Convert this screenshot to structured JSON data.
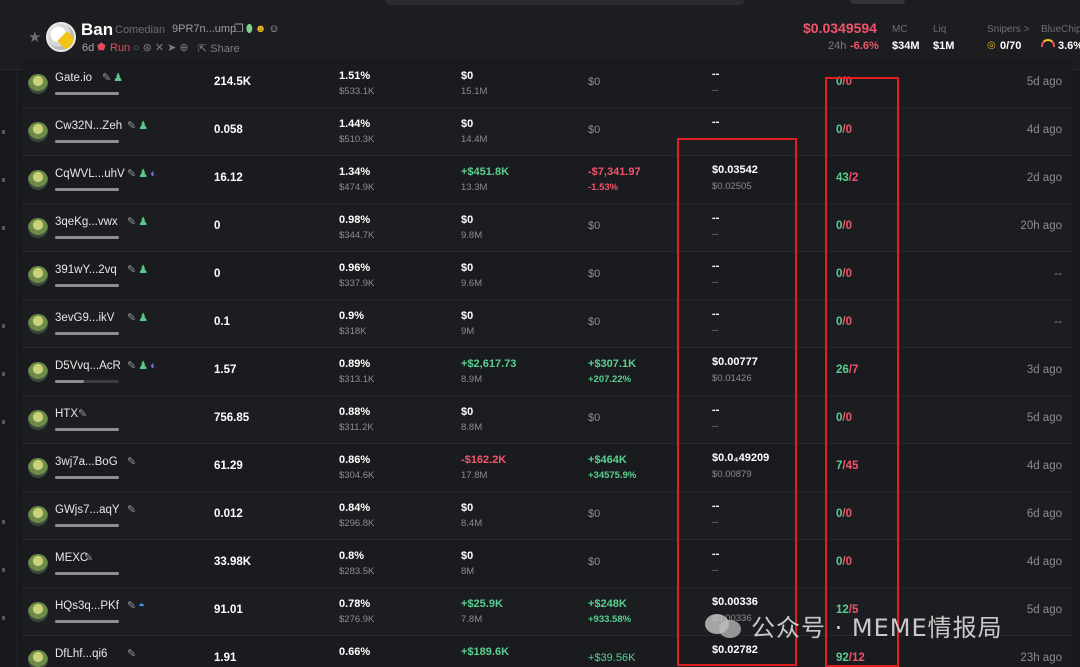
{
  "header": {
    "token_name": "Ban",
    "token_full_name": "Comedian",
    "token_address": "9PR7n...ump",
    "age": "6d",
    "run_label": "Run",
    "share_label": "Share",
    "price": "$0.0349594",
    "change_label": "24h",
    "change_value": "-6.6%",
    "mc_label": "MC",
    "mc_value": "$34M",
    "liq_label": "Liq",
    "liq_value": "$1M",
    "snipers_label": "Snipers >",
    "snipers_value": "0/70",
    "bluechip_label": "BlueChip",
    "bluechip_value": "3.6%"
  },
  "rows": [
    {
      "name": "Gate.io",
      "icons": [
        "pencil",
        "person"
      ],
      "bar": 1.0,
      "balance": "214.5K",
      "pct": "1.51%",
      "pct_usd": "$533.1K",
      "bought": "$0",
      "bought_class": "",
      "bought_sub": "15.1M",
      "pnl": "$0",
      "pnl_class": "",
      "pnl_sub": "",
      "pnl_sub_class": "",
      "avg": "--",
      "avg_sub": "--",
      "buys": "0",
      "sells": "0",
      "age": "5d ago"
    },
    {
      "name": "Cw32N...Zeh",
      "icons": [
        "pencil",
        "person"
      ],
      "bar": 1.0,
      "balance": "0.058",
      "pct": "1.44%",
      "pct_usd": "$510.3K",
      "bought": "$0",
      "bought_class": "",
      "bought_sub": "14.4M",
      "pnl": "$0",
      "pnl_class": "",
      "pnl_sub": "",
      "pnl_sub_class": "",
      "avg": "--",
      "avg_sub": "",
      "buys": "0",
      "sells": "0",
      "age": "4d ago"
    },
    {
      "name": "CqWVL...uhV",
      "icons": [
        "pencil",
        "person",
        "moon"
      ],
      "bar": 1.0,
      "balance": "16.12",
      "pct": "1.34%",
      "pct_usd": "$474.9K",
      "bought": "+$451.8K",
      "bought_class": "up",
      "bought_sub": "13.3M",
      "pnl": "-$7,341.97",
      "pnl_class": "down",
      "pnl_sub": "-1.53%",
      "pnl_sub_class": "down",
      "avg": "$0.03542",
      "avg_sub": "$0.02505",
      "buys": "43",
      "sells": "2",
      "age": "2d ago"
    },
    {
      "name": "3qeKg...vwx",
      "icons": [
        "pencil",
        "person"
      ],
      "bar": 1.0,
      "balance": "0",
      "pct": "0.98%",
      "pct_usd": "$344.7K",
      "bought": "$0",
      "bought_class": "",
      "bought_sub": "9.8M",
      "pnl": "$0",
      "pnl_class": "",
      "pnl_sub": "",
      "pnl_sub_class": "",
      "avg": "--",
      "avg_sub": "--",
      "buys": "0",
      "sells": "0",
      "age": "20h ago"
    },
    {
      "name": "391wY...2vq",
      "icons": [
        "pencil",
        "person"
      ],
      "bar": 1.0,
      "balance": "0",
      "pct": "0.96%",
      "pct_usd": "$337.9K",
      "bought": "$0",
      "bought_class": "",
      "bought_sub": "9.6M",
      "pnl": "$0",
      "pnl_class": "",
      "pnl_sub": "",
      "pnl_sub_class": "",
      "avg": "--",
      "avg_sub": "--",
      "buys": "0",
      "sells": "0",
      "age": "--"
    },
    {
      "name": "3evG9...ikV",
      "icons": [
        "pencil",
        "person"
      ],
      "bar": 1.0,
      "balance": "0.1",
      "pct": "0.9%",
      "pct_usd": "$318K",
      "bought": "$0",
      "bought_class": "",
      "bought_sub": "9M",
      "pnl": "$0",
      "pnl_class": "",
      "pnl_sub": "",
      "pnl_sub_class": "",
      "avg": "--",
      "avg_sub": "--",
      "buys": "0",
      "sells": "0",
      "age": "--"
    },
    {
      "name": "D5Vvq...AcR",
      "icons": [
        "pencil",
        "person",
        "moon"
      ],
      "bar": 0.45,
      "balance": "1.57",
      "pct": "0.89%",
      "pct_usd": "$313.1K",
      "bought": "+$2,617.73",
      "bought_class": "up",
      "bought_sub": "8.9M",
      "pnl": "+$307.1K",
      "pnl_class": "up",
      "pnl_sub": "+207.22%",
      "pnl_sub_class": "up",
      "avg": "$0.00777",
      "avg_sub": "$0.01426",
      "buys": "26",
      "sells": "7",
      "age": "3d ago"
    },
    {
      "name": "HTX",
      "icons": [
        "pencil"
      ],
      "bar": 1.0,
      "balance": "756.85",
      "pct": "0.88%",
      "pct_usd": "$311.2K",
      "bought": "$0",
      "bought_class": "",
      "bought_sub": "8.8M",
      "pnl": "$0",
      "pnl_class": "",
      "pnl_sub": "",
      "pnl_sub_class": "",
      "avg": "--",
      "avg_sub": "--",
      "buys": "0",
      "sells": "0",
      "age": "5d ago"
    },
    {
      "name": "3wj7a...BoG",
      "icons": [
        "pencil"
      ],
      "bar": 1.0,
      "balance": "61.29",
      "pct": "0.86%",
      "pct_usd": "$304.6K",
      "bought": "-$162.2K",
      "bought_class": "down",
      "bought_sub": "17.8M",
      "pnl": "+$464K",
      "pnl_class": "up",
      "pnl_sub": "+34575.9%",
      "pnl_sub_class": "up",
      "avg": "$0.0₄49209",
      "avg_sub": "$0.00879",
      "buys": "7",
      "sells": "45",
      "age": "4d ago"
    },
    {
      "name": "GWjs7...aqY",
      "icons": [
        "pencil"
      ],
      "bar": 1.0,
      "balance": "0.012",
      "pct": "0.84%",
      "pct_usd": "$296.8K",
      "bought": "$0",
      "bought_class": "",
      "bought_sub": "8.4M",
      "pnl": "$0",
      "pnl_class": "",
      "pnl_sub": "",
      "pnl_sub_class": "",
      "avg": "--",
      "avg_sub": "--",
      "buys": "0",
      "sells": "0",
      "age": "6d ago"
    },
    {
      "name": "MEXC",
      "icons": [
        "pencil"
      ],
      "bar": 1.0,
      "balance": "33.98K",
      "pct": "0.8%",
      "pct_usd": "$283.5K",
      "bought": "$0",
      "bought_class": "",
      "bought_sub": "8M",
      "pnl": "$0",
      "pnl_class": "",
      "pnl_sub": "",
      "pnl_sub_class": "",
      "avg": "--",
      "avg_sub": "--",
      "buys": "0",
      "sells": "0",
      "age": "4d ago"
    },
    {
      "name": "HQs3q...PKf",
      "icons": [
        "pencil",
        "fish"
      ],
      "bar": 1.0,
      "balance": "91.01",
      "pct": "0.78%",
      "pct_usd": "$276.9K",
      "bought": "+$25.9K",
      "bought_class": "up",
      "bought_sub": "7.8M",
      "pnl": "+$248K",
      "pnl_class": "up",
      "pnl_sub": "+933.58%",
      "pnl_sub_class": "up",
      "avg": "$0.00336",
      "avg_sub": "$0.00336",
      "buys": "12",
      "sells": "5",
      "age": "5d ago"
    },
    {
      "name": "DfLhf...qi6",
      "icons": [
        "pencil"
      ],
      "bar": 1.0,
      "balance": "1.91",
      "pct": "0.66%",
      "pct_usd": "",
      "bought": "+$189.6K",
      "bought_class": "up",
      "bought_sub": "",
      "pnl": "+$39.56K",
      "pnl_class": "up",
      "pnl_sub": "",
      "pnl_sub_class": "",
      "avg": "$0.02782",
      "avg_sub": "",
      "buys": "92",
      "sells": "12",
      "age": "23h ago"
    }
  ],
  "icon_glyphs": {
    "pencil": "✎",
    "person": "♟",
    "moon": "◐",
    "fish": "◓"
  },
  "watermark": "公众号 · MEME情报局",
  "colors": {
    "up": "#59cf8f",
    "down": "#f0566b",
    "price": "#f0566b",
    "highlight": "#e02020"
  }
}
